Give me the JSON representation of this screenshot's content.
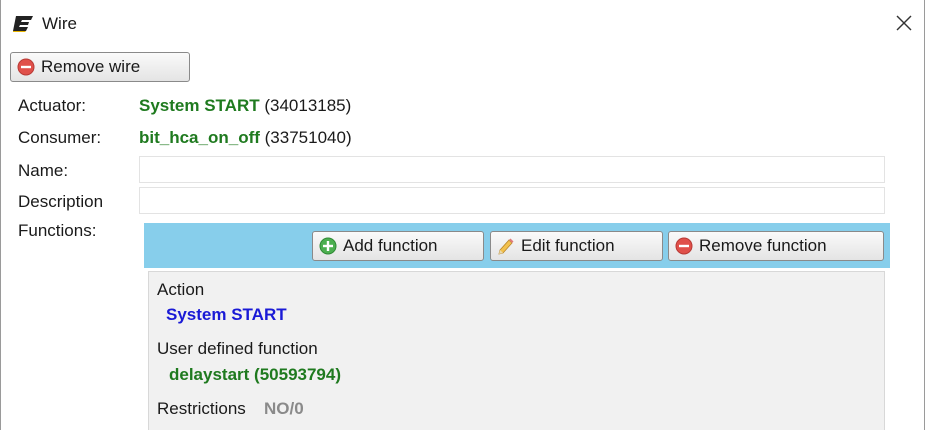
{
  "window": {
    "title": "Wire",
    "close_symbol": "✕"
  },
  "toolbar": {
    "remove_wire_label": "Remove wire"
  },
  "form": {
    "actuator_label": "Actuator:",
    "actuator_name": "System START",
    "actuator_id": "(34013185)",
    "consumer_label": "Consumer:",
    "consumer_name": "bit_hca_on_off",
    "consumer_id": "(33751040)",
    "name_label": "Name:",
    "name_value": "",
    "description_label": "Description",
    "description_value": "",
    "functions_label": "Functions:"
  },
  "functions": {
    "add_label": "Add function",
    "edit_label": "Edit function",
    "remove_label": "Remove function",
    "selected": {
      "action_heading": "Action",
      "action_value": "System START",
      "udf_heading": "User defined function",
      "udf_value": "delaystart (50593794)",
      "restrictions_heading": "Restrictions",
      "restrictions_value": "NO/0"
    }
  },
  "colors": {
    "accent_green": "#1f7a1f",
    "accent_blue": "#1a1ad6",
    "toolbar_blue": "#87ceeb",
    "remove_red": "#e0504a",
    "add_green": "#4caf50"
  },
  "icons": {
    "app": "app-logo-icon",
    "remove": "minus-circle-icon",
    "add": "plus-circle-icon",
    "edit": "pencil-icon",
    "close": "close-icon"
  }
}
